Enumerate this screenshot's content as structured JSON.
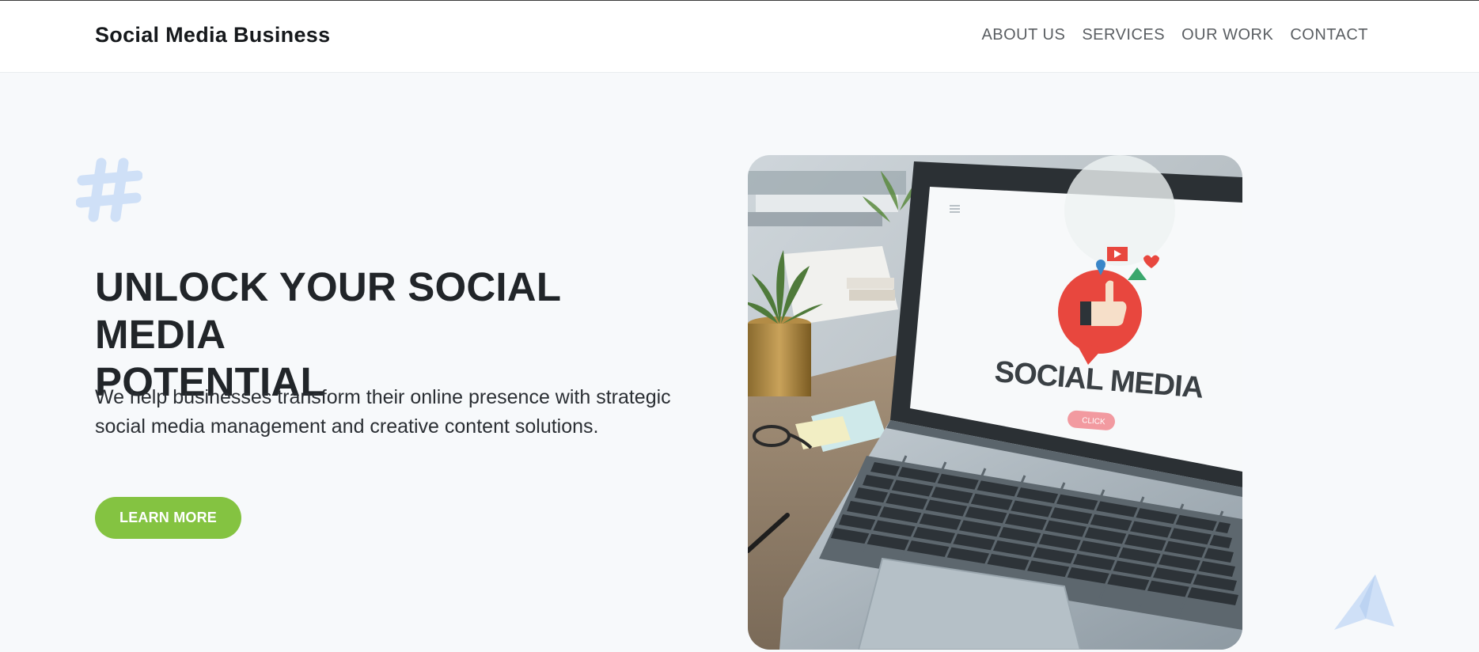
{
  "header": {
    "brand": "Social Media Business",
    "nav": [
      {
        "label": "ABOUT US"
      },
      {
        "label": "SERVICES"
      },
      {
        "label": "OUR WORK"
      },
      {
        "label": "CONTACT"
      }
    ]
  },
  "hero": {
    "title_line1": "UNLOCK YOUR SOCIAL MEDIA",
    "title_line2": "POTENTIAL",
    "description": "We help businesses transform their online presence with strategic social media management and creative content solutions.",
    "cta_label": "LEARN MORE",
    "image": {
      "screen_text": "SOCIAL MEDIA",
      "screen_button": "CLICK"
    }
  },
  "decorations": {
    "hash_icon": "hashtag-icon",
    "plane_icon": "paper-plane-icon",
    "color": "#cfe0f7"
  },
  "colors": {
    "accent": "#84c341",
    "heading": "#212529",
    "nav_text": "#5a5e62",
    "background": "#f7f9fb"
  }
}
